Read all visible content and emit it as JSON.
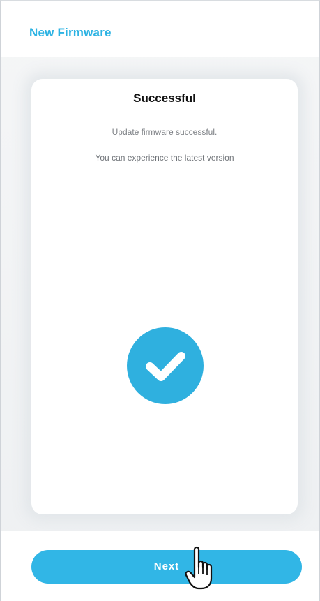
{
  "header": {
    "title": "New Firmware"
  },
  "card": {
    "title": "Successful",
    "line1": "Update firmware successful.",
    "line2": "You can experience the latest version",
    "status_icon": "checkmark-circle-icon"
  },
  "actions": {
    "next_label": "Next"
  },
  "cursor": {
    "icon": "hand-pointer-icon"
  },
  "colors": {
    "accent": "#2db3e3",
    "button": "#31b6e6",
    "circle": "#2fb0df"
  }
}
